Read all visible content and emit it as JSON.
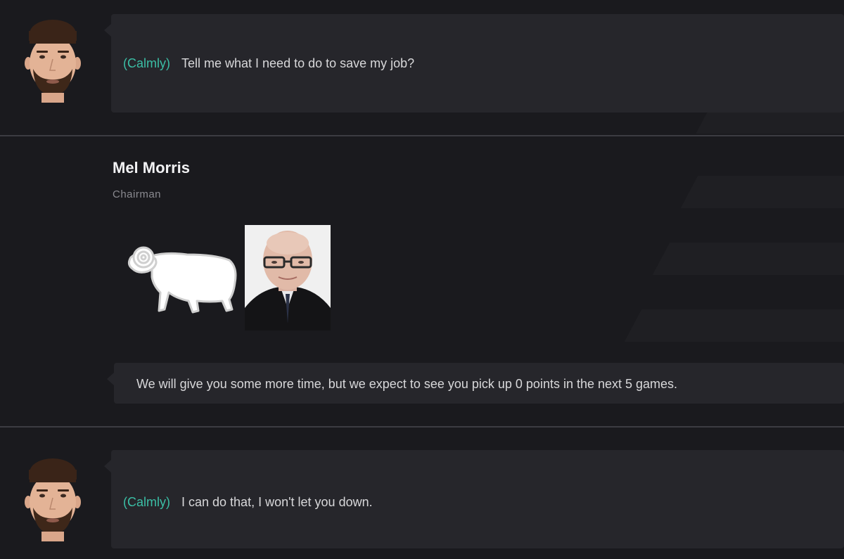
{
  "colors": {
    "background": "#1a1a1e",
    "bubble": "#26262b",
    "tone_accent": "#3bbfa6",
    "divider": "#3c3c42"
  },
  "messages": [
    {
      "speaker": "manager",
      "avatar_icon": "manager-face-icon",
      "tone": "(Calmly)",
      "text": "Tell me what I need to do to save my job?"
    },
    {
      "speaker": "chairman",
      "name": "Mel Morris",
      "role": "Chairman",
      "club_badge_icon": "ram-badge-icon",
      "photo_icon": "chairman-portrait-icon",
      "text": "We will give you some more time, but we expect to see you pick up 0 points in the next 5 games."
    },
    {
      "speaker": "manager",
      "avatar_icon": "manager-face-icon",
      "tone": "(Calmly)",
      "text": "I can do that, I won't let you down."
    }
  ]
}
